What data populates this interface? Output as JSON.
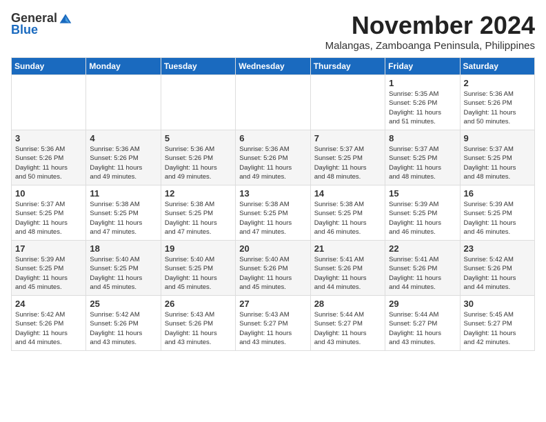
{
  "logo": {
    "general": "General",
    "blue": "Blue"
  },
  "title": {
    "month": "November 2024",
    "location": "Malangas, Zamboanga Peninsula, Philippines"
  },
  "headers": [
    "Sunday",
    "Monday",
    "Tuesday",
    "Wednesday",
    "Thursday",
    "Friday",
    "Saturday"
  ],
  "weeks": [
    [
      {
        "day": "",
        "info": ""
      },
      {
        "day": "",
        "info": ""
      },
      {
        "day": "",
        "info": ""
      },
      {
        "day": "",
        "info": ""
      },
      {
        "day": "",
        "info": ""
      },
      {
        "day": "1",
        "info": "Sunrise: 5:35 AM\nSunset: 5:26 PM\nDaylight: 11 hours\nand 51 minutes."
      },
      {
        "day": "2",
        "info": "Sunrise: 5:36 AM\nSunset: 5:26 PM\nDaylight: 11 hours\nand 50 minutes."
      }
    ],
    [
      {
        "day": "3",
        "info": "Sunrise: 5:36 AM\nSunset: 5:26 PM\nDaylight: 11 hours\nand 50 minutes."
      },
      {
        "day": "4",
        "info": "Sunrise: 5:36 AM\nSunset: 5:26 PM\nDaylight: 11 hours\nand 49 minutes."
      },
      {
        "day": "5",
        "info": "Sunrise: 5:36 AM\nSunset: 5:26 PM\nDaylight: 11 hours\nand 49 minutes."
      },
      {
        "day": "6",
        "info": "Sunrise: 5:36 AM\nSunset: 5:26 PM\nDaylight: 11 hours\nand 49 minutes."
      },
      {
        "day": "7",
        "info": "Sunrise: 5:37 AM\nSunset: 5:25 PM\nDaylight: 11 hours\nand 48 minutes."
      },
      {
        "day": "8",
        "info": "Sunrise: 5:37 AM\nSunset: 5:25 PM\nDaylight: 11 hours\nand 48 minutes."
      },
      {
        "day": "9",
        "info": "Sunrise: 5:37 AM\nSunset: 5:25 PM\nDaylight: 11 hours\nand 48 minutes."
      }
    ],
    [
      {
        "day": "10",
        "info": "Sunrise: 5:37 AM\nSunset: 5:25 PM\nDaylight: 11 hours\nand 48 minutes."
      },
      {
        "day": "11",
        "info": "Sunrise: 5:38 AM\nSunset: 5:25 PM\nDaylight: 11 hours\nand 47 minutes."
      },
      {
        "day": "12",
        "info": "Sunrise: 5:38 AM\nSunset: 5:25 PM\nDaylight: 11 hours\nand 47 minutes."
      },
      {
        "day": "13",
        "info": "Sunrise: 5:38 AM\nSunset: 5:25 PM\nDaylight: 11 hours\nand 47 minutes."
      },
      {
        "day": "14",
        "info": "Sunrise: 5:38 AM\nSunset: 5:25 PM\nDaylight: 11 hours\nand 46 minutes."
      },
      {
        "day": "15",
        "info": "Sunrise: 5:39 AM\nSunset: 5:25 PM\nDaylight: 11 hours\nand 46 minutes."
      },
      {
        "day": "16",
        "info": "Sunrise: 5:39 AM\nSunset: 5:25 PM\nDaylight: 11 hours\nand 46 minutes."
      }
    ],
    [
      {
        "day": "17",
        "info": "Sunrise: 5:39 AM\nSunset: 5:25 PM\nDaylight: 11 hours\nand 45 minutes."
      },
      {
        "day": "18",
        "info": "Sunrise: 5:40 AM\nSunset: 5:25 PM\nDaylight: 11 hours\nand 45 minutes."
      },
      {
        "day": "19",
        "info": "Sunrise: 5:40 AM\nSunset: 5:25 PM\nDaylight: 11 hours\nand 45 minutes."
      },
      {
        "day": "20",
        "info": "Sunrise: 5:40 AM\nSunset: 5:26 PM\nDaylight: 11 hours\nand 45 minutes."
      },
      {
        "day": "21",
        "info": "Sunrise: 5:41 AM\nSunset: 5:26 PM\nDaylight: 11 hours\nand 44 minutes."
      },
      {
        "day": "22",
        "info": "Sunrise: 5:41 AM\nSunset: 5:26 PM\nDaylight: 11 hours\nand 44 minutes."
      },
      {
        "day": "23",
        "info": "Sunrise: 5:42 AM\nSunset: 5:26 PM\nDaylight: 11 hours\nand 44 minutes."
      }
    ],
    [
      {
        "day": "24",
        "info": "Sunrise: 5:42 AM\nSunset: 5:26 PM\nDaylight: 11 hours\nand 44 minutes."
      },
      {
        "day": "25",
        "info": "Sunrise: 5:42 AM\nSunset: 5:26 PM\nDaylight: 11 hours\nand 43 minutes."
      },
      {
        "day": "26",
        "info": "Sunrise: 5:43 AM\nSunset: 5:26 PM\nDaylight: 11 hours\nand 43 minutes."
      },
      {
        "day": "27",
        "info": "Sunrise: 5:43 AM\nSunset: 5:27 PM\nDaylight: 11 hours\nand 43 minutes."
      },
      {
        "day": "28",
        "info": "Sunrise: 5:44 AM\nSunset: 5:27 PM\nDaylight: 11 hours\nand 43 minutes."
      },
      {
        "day": "29",
        "info": "Sunrise: 5:44 AM\nSunset: 5:27 PM\nDaylight: 11 hours\nand 43 minutes."
      },
      {
        "day": "30",
        "info": "Sunrise: 5:45 AM\nSunset: 5:27 PM\nDaylight: 11 hours\nand 42 minutes."
      }
    ]
  ]
}
